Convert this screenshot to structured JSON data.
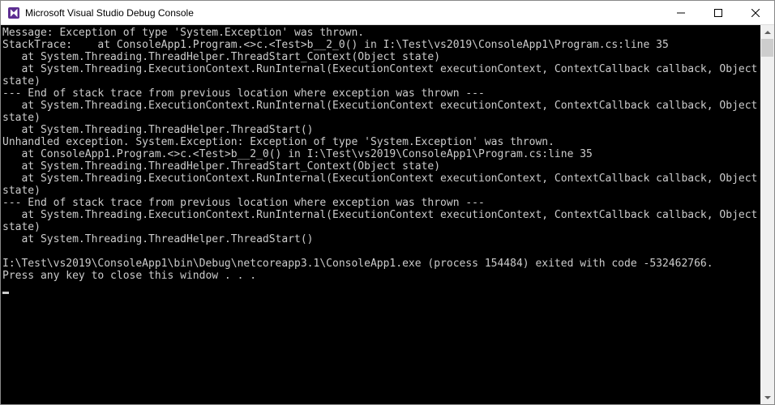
{
  "titlebar": {
    "title": "Microsoft Visual Studio Debug Console"
  },
  "console": {
    "lines": [
      "Message: Exception of type 'System.Exception' was thrown.",
      "StackTrace:    at ConsoleApp1.Program.<>c.<Test>b__2_0() in I:\\Test\\vs2019\\ConsoleApp1\\Program.cs:line 35",
      "   at System.Threading.ThreadHelper.ThreadStart_Context(Object state)",
      "   at System.Threading.ExecutionContext.RunInternal(ExecutionContext executionContext, ContextCallback callback, Object state)",
      "--- End of stack trace from previous location where exception was thrown ---",
      "   at System.Threading.ExecutionContext.RunInternal(ExecutionContext executionContext, ContextCallback callback, Object state)",
      "   at System.Threading.ThreadHelper.ThreadStart()",
      "Unhandled exception. System.Exception: Exception of type 'System.Exception' was thrown.",
      "   at ConsoleApp1.Program.<>c.<Test>b__2_0() in I:\\Test\\vs2019\\ConsoleApp1\\Program.cs:line 35",
      "   at System.Threading.ThreadHelper.ThreadStart_Context(Object state)",
      "   at System.Threading.ExecutionContext.RunInternal(ExecutionContext executionContext, ContextCallback callback, Object state)",
      "--- End of stack trace from previous location where exception was thrown ---",
      "   at System.Threading.ExecutionContext.RunInternal(ExecutionContext executionContext, ContextCallback callback, Object state)",
      "   at System.Threading.ThreadHelper.ThreadStart()",
      "",
      "I:\\Test\\vs2019\\ConsoleApp1\\bin\\Debug\\netcoreapp3.1\\ConsoleApp1.exe (process 154484) exited with code -532462766.",
      "Press any key to close this window . . ."
    ]
  }
}
